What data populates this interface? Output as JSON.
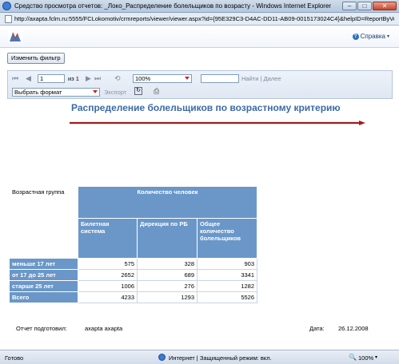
{
  "window": {
    "title": "Средство просмотра отчетов: _Локо_Распределение болельщиков по возрасту - Windows Internet Explorer",
    "minimize": "–",
    "maximize": "□",
    "close": "✕"
  },
  "address": {
    "url": "http://axapta.fclm.ru:5555/FCLokomotiv/crmreports/viewer/viewer.aspx?id={95E329C3-D4AC-DD11-AB09-0015173024C4}&helpID=ReportByVo"
  },
  "toolbar": {
    "help_label": "Справка",
    "help_chevron": "▾"
  },
  "filter": {
    "button_label": "Изменить фильтр"
  },
  "report_toolbar": {
    "first_page": "⏮",
    "prev_page": "◀",
    "page_value": "1",
    "page_of": "из 1",
    "next_page": "▶",
    "last_page": "⏭",
    "back": "⟲",
    "zoom_value": "100%",
    "find_label": "Найти",
    "find_sep": " | ",
    "next_label": "Далее",
    "format_placeholder": "Выбрать формат",
    "export_label": "Экспорт",
    "refresh": "↻",
    "print": "⎙"
  },
  "report": {
    "title": "Распределение болельщиков по возрастному критерию",
    "arrow_color": "#a01c1c",
    "table": {
      "corner_label": "Возрастная группа",
      "group_header": "Количество человек",
      "columns": [
        "Билетная система",
        "Дирекция по РБ",
        "Общее количество болельщиков"
      ],
      "rows": [
        {
          "label": "меньше 17 лет",
          "values": [
            "575",
            "328",
            "903"
          ]
        },
        {
          "label": "от 17 до 25 лет",
          "values": [
            "2652",
            "689",
            "3341"
          ]
        },
        {
          "label": "старше 25 лет",
          "values": [
            "1006",
            "276",
            "1282"
          ]
        },
        {
          "label": "Всего",
          "values": [
            "4233",
            "1293",
            "5526"
          ]
        }
      ],
      "header_color": "#6a97c8"
    },
    "prepared_by_label": "Отчет подготовил:",
    "prepared_by_value": "axapta axapta",
    "date_label": "Дата:",
    "date_value": "26.12.2008"
  },
  "status": {
    "text": "Готово",
    "zone": "Интернет | Защищенный режим: вкл.",
    "zoom": "100%",
    "zoom_icon": "🔍",
    "zoom_chevron": "▾"
  }
}
